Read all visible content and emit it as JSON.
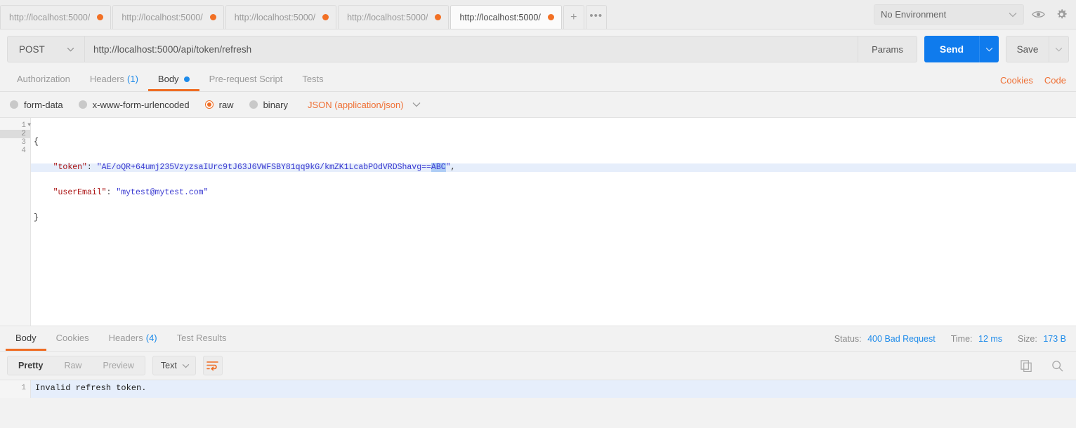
{
  "window": {
    "app": "Postman"
  },
  "tabbar": {
    "tabs": [
      {
        "label": "http://localhost:5000/",
        "active": false,
        "unsaved": true
      },
      {
        "label": "http://localhost:5000/",
        "active": false,
        "unsaved": true
      },
      {
        "label": "http://localhost:5000/",
        "active": false,
        "unsaved": true
      },
      {
        "label": "http://localhost:5000/",
        "active": false,
        "unsaved": true
      },
      {
        "label": "http://localhost:5000/",
        "active": true,
        "unsaved": true
      }
    ],
    "new_tab_label": "+",
    "more_label": "•••",
    "environment": {
      "selected": "No Environment",
      "caret_icon": "chevron-down-icon"
    },
    "eye_icon": "eye-icon",
    "settings_icon": "gear-icon"
  },
  "request": {
    "method": "POST",
    "url": "http://localhost:5000/api/token/refresh",
    "params_label": "Params",
    "send_label": "Send",
    "save_label": "Save",
    "tabs": [
      {
        "label": "Authorization",
        "active": false,
        "count": "",
        "dot": false
      },
      {
        "label": "Headers",
        "active": false,
        "count": "(1)",
        "dot": false
      },
      {
        "label": "Body",
        "active": true,
        "count": "",
        "dot": true
      },
      {
        "label": "Pre-request Script",
        "active": false,
        "count": "",
        "dot": false
      },
      {
        "label": "Tests",
        "active": false,
        "count": "",
        "dot": false
      }
    ],
    "cookies_link": "Cookies",
    "code_link": "Code",
    "body_types": [
      {
        "label": "form-data",
        "selected": false
      },
      {
        "label": "x-www-form-urlencoded",
        "selected": false
      },
      {
        "label": "raw",
        "selected": true
      },
      {
        "label": "binary",
        "selected": false
      }
    ],
    "raw_format": "JSON (application/json)",
    "editor": {
      "lines": [
        {
          "num": "1",
          "fold": true,
          "highlight": false
        },
        {
          "num": "2",
          "fold": false,
          "highlight": true
        },
        {
          "num": "3",
          "fold": false,
          "highlight": false
        },
        {
          "num": "4",
          "fold": false,
          "highlight": false
        }
      ],
      "line1_open_brace": "{",
      "line2_key": "\"token\"",
      "line2_colon": ": ",
      "line2_value_prefix": "\"AE/oQR+64umj235VzyzsaIUrc9tJ63J6VWFSBY81qq9kG/kmZK1LcabPOdVRDShavg==",
      "line2_value_selected": "ABC",
      "line2_value_suffix": "\"",
      "line2_comma": ",",
      "line3_key": "\"userEmail\"",
      "line3_colon": ": ",
      "line3_value": "\"mytest@mytest.com\"",
      "line4_close_brace": "}"
    }
  },
  "response": {
    "tabs": [
      {
        "label": "Body",
        "active": true,
        "count": ""
      },
      {
        "label": "Cookies",
        "active": false,
        "count": ""
      },
      {
        "label": "Headers",
        "active": false,
        "count": "(4)"
      },
      {
        "label": "Test Results",
        "active": false,
        "count": ""
      }
    ],
    "status_label": "Status:",
    "status_value": "400 Bad Request",
    "time_label": "Time:",
    "time_value": "12 ms",
    "size_label": "Size:",
    "size_value": "173 B",
    "view_modes": [
      {
        "label": "Pretty",
        "active": true
      },
      {
        "label": "Raw",
        "active": false
      },
      {
        "label": "Preview",
        "active": false
      }
    ],
    "format": "Text",
    "wrap_icon": "word-wrap-icon",
    "copy_icon": "copy-icon",
    "search_icon": "search-icon",
    "body_line_number": "1",
    "body_text": "Invalid refresh token."
  },
  "colors": {
    "accent_orange": "#ef6c22",
    "accent_blue": "#0f7bed",
    "link_blue": "#1e8bea",
    "chrome_bg": "#f2f2f2"
  }
}
